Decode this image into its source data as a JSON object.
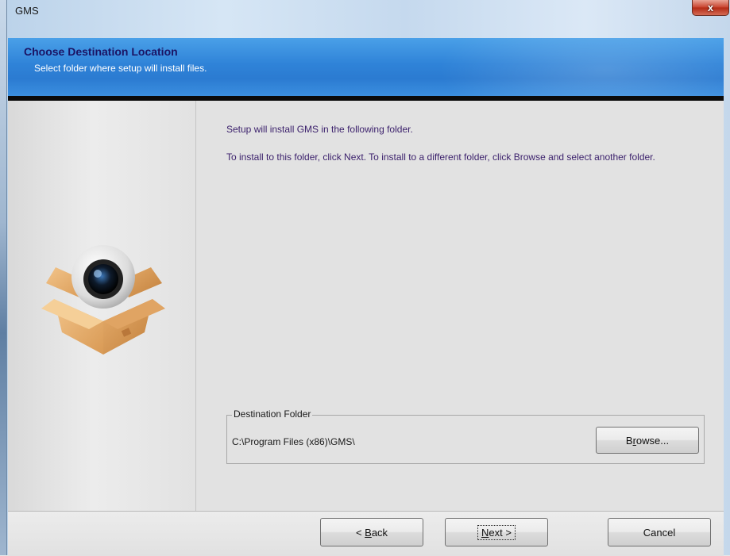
{
  "window": {
    "title": "GMS",
    "close_label": "x"
  },
  "banner": {
    "heading": "Choose Destination Location",
    "subheading": "Select folder where setup will install files."
  },
  "content": {
    "line1": "Setup will install GMS in the following folder.",
    "line2": "To install to this folder, click Next. To install to a different folder, click Browse and select another folder."
  },
  "destination": {
    "legend": "Destination Folder",
    "path": "C:\\Program Files (x86)\\GMS\\",
    "browse_prefix": "B",
    "browse_mnemonic": "r",
    "browse_suffix": "owse..."
  },
  "buttons": {
    "back_prefix": "< ",
    "back_mnemonic": "B",
    "back_suffix": "ack",
    "next_mnemonic": "N",
    "next_suffix": "ext >",
    "cancel": "Cancel"
  },
  "icons": {
    "product": "camera-in-box-icon"
  },
  "colors": {
    "banner_blue": "#2f83d8",
    "heading": "#1b1464",
    "close_red": "#c8422d"
  }
}
